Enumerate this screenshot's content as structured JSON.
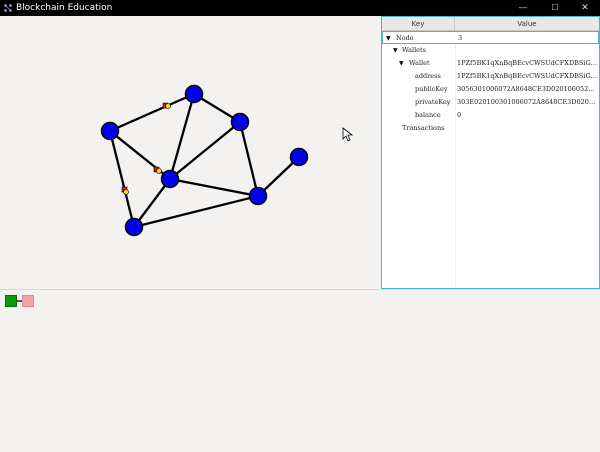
{
  "window": {
    "title": "Blockchain Education",
    "controls": {
      "minimize": "—",
      "maximize": "☐",
      "close": "✕"
    }
  },
  "tree": {
    "headers": {
      "key": "Key",
      "value": "Value"
    },
    "rows": [
      {
        "key": "Node",
        "value": "3",
        "expanded": true
      },
      {
        "key": "Wallets",
        "value": "",
        "expanded": true
      },
      {
        "key": "Wallet",
        "value": "1PZf5BK1qXnBqBEcvCWSUdCFXDBSiG3yW4",
        "expanded": true
      },
      {
        "key": "address",
        "value": "1PZf5BK1qXnBqBEcvCWSUdCFXDBSiG3yW4"
      },
      {
        "key": "publicKey",
        "value": "3056301006072A8648CE3D020106052B8104000..."
      },
      {
        "key": "privateKey",
        "value": "303E020100301006072A8648CE3D020106052B81..."
      },
      {
        "key": "balance",
        "value": "0"
      },
      {
        "key": "Transactions",
        "value": ""
      }
    ]
  },
  "network": {
    "node_color": "#0000ee",
    "edge_color": "#000000",
    "packet_colors": [
      "#e01010",
      "#f0e020"
    ]
  },
  "legend": {
    "colors": [
      "#0a9a0a",
      "#f2a5a9"
    ]
  }
}
